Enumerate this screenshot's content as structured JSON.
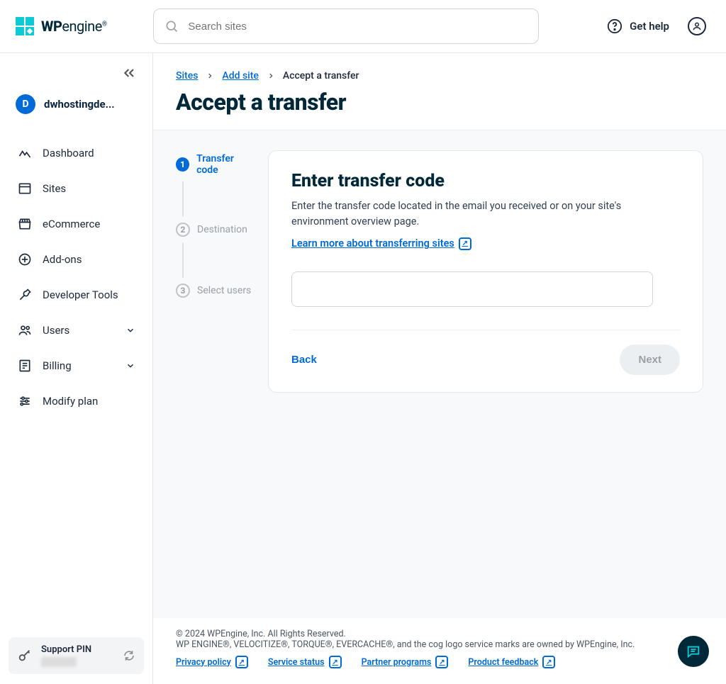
{
  "header": {
    "search_placeholder": "Search sites",
    "get_help": "Get help"
  },
  "account": {
    "initial": "D",
    "name": "dwhostingde..."
  },
  "sidebar": {
    "items": [
      {
        "label": "Dashboard"
      },
      {
        "label": "Sites"
      },
      {
        "label": "eCommerce"
      },
      {
        "label": "Add-ons"
      },
      {
        "label": "Developer Tools"
      },
      {
        "label": "Users"
      },
      {
        "label": "Billing"
      },
      {
        "label": "Modify plan"
      }
    ],
    "support_pin_label": "Support PIN"
  },
  "breadcrumb": {
    "sites": "Sites",
    "add_site": "Add site",
    "current": "Accept a transfer"
  },
  "page": {
    "title": "Accept a transfer"
  },
  "stepper": {
    "steps": [
      {
        "num": "1",
        "label": "Transfer code"
      },
      {
        "num": "2",
        "label": "Destination"
      },
      {
        "num": "3",
        "label": "Select users"
      }
    ]
  },
  "card": {
    "title": "Enter transfer code",
    "body": "Enter the transfer code located in the email you received or on your site's environment overview page.",
    "learn_link": "Learn more about transferring sites",
    "back": "Back",
    "next": "Next"
  },
  "footer": {
    "line1": "© 2024 WPEngine, Inc. All Rights Reserved.",
    "line2": "WP ENGINE®, VELOCITIZE®, TORQUE®, EVERCACHE®, and the cog logo service marks are owned by WPEngine, Inc.",
    "links": [
      "Privacy policy",
      "Service status",
      "Partner programs",
      "Product feedback"
    ]
  }
}
